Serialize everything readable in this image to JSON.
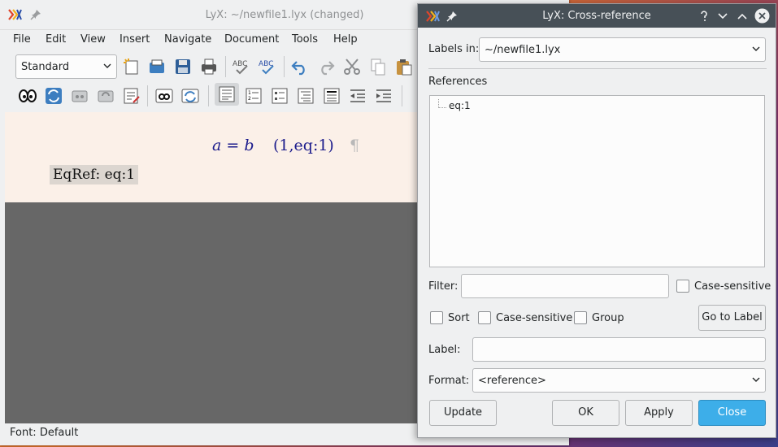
{
  "main_window": {
    "title": "LyX: ~/newfile1.lyx (changed)",
    "menu": [
      "File",
      "Edit",
      "View",
      "Insert",
      "Navigate",
      "Document",
      "Tools",
      "Help"
    ],
    "paragraph_style": "Standard",
    "document": {
      "equation_lhs": "a",
      "equation_op": "=",
      "equation_rhs": "b",
      "equation_label": "(1,eq:1)",
      "pilcrow": "¶",
      "eqref_text": "EqRef: eq:1"
    },
    "status": "Font: Default"
  },
  "dialog": {
    "title": "LyX: Cross-reference",
    "labels_in_label": "Labels in:",
    "labels_in_value": "~/newfile1.lyx",
    "references_heading": "References",
    "references": [
      "eq:1"
    ],
    "filter_label": "Filter:",
    "filter_value": "",
    "case_sensitive_filter": "Case-sensitive",
    "sort_label": "Sort",
    "case_sensitive_label": "Case-sensitive",
    "group_label": "Group",
    "go_to_label_button": "Go to Label",
    "label_label": "Label:",
    "label_value": "",
    "format_label": "Format:",
    "format_value": "<reference>",
    "update_button": "Update",
    "ok_button": "OK",
    "apply_button": "Apply",
    "close_button": "Close"
  },
  "colors": {
    "accent": "#3daee9",
    "dialog_titlebar": "#475057",
    "doc_background": "#fbf0e8",
    "math_text": "#1c1c8c"
  }
}
